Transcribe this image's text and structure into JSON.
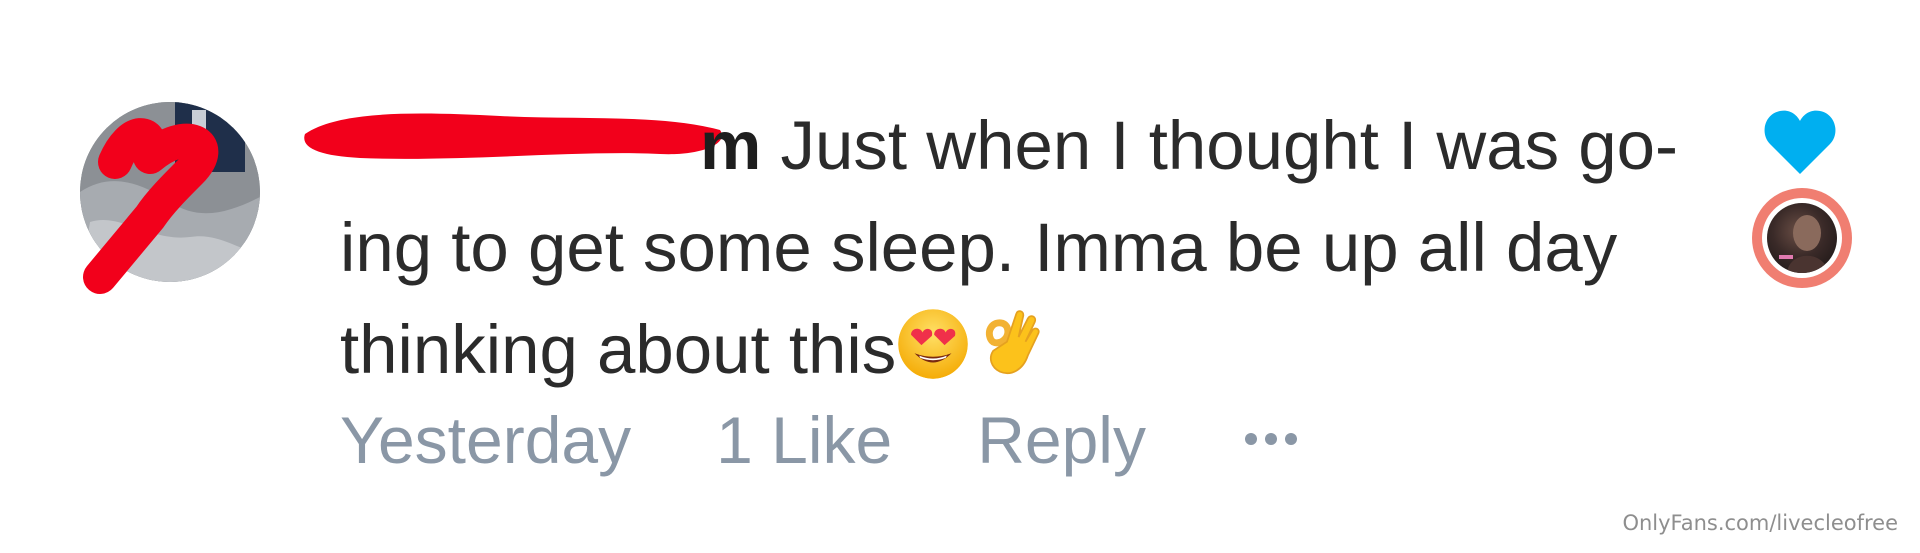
{
  "comment": {
    "username_visible_fragment": "m",
    "text": "Just when I thought I was go-ing to get some sleep. Imma be up all day thinking about this",
    "text_line1": " Just when I thought I was go-",
    "text_line2": "ing to get some sleep. Imma be up all day",
    "text_line3": "thinking about this",
    "emojis": [
      "heart-eyes-emoji",
      "ok-hand-emoji"
    ],
    "timestamp": "Yesterday",
    "likes_label": "1 Like",
    "reply_label": "Reply",
    "more_icon": "ellipsis-icon"
  },
  "actions": {
    "like_icon": "heart-icon",
    "like_color": "#00aff0",
    "creator_avatar_ring_color": "#f07e71"
  },
  "colors": {
    "text": "#2b2b2b",
    "meta": "#8a97a6",
    "redaction": "#f2001b"
  },
  "watermark": "OnlyFans.com/livecleofree"
}
